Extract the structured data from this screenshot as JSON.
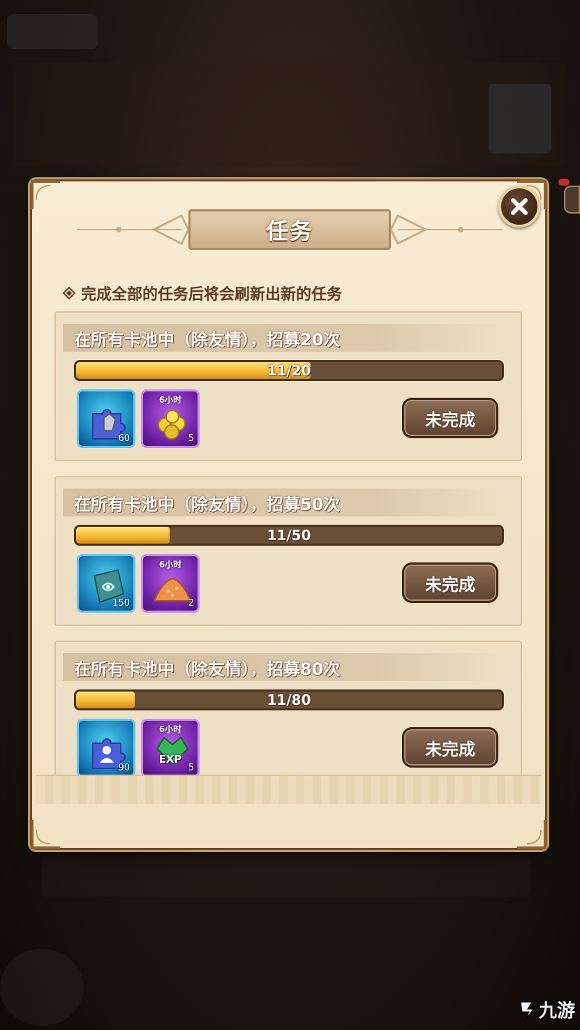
{
  "dialog": {
    "title": "任务"
  },
  "hint": "完成全部的任务后将会刷新出新的任务",
  "tasks": [
    {
      "title": "在所有卡池中（除友情），招募20次",
      "progress_text": "11/20",
      "progress": 0.55,
      "status": "未完成",
      "rewards": [
        {
          "icon": "hero-fragment-icon",
          "qty": "60"
        },
        {
          "icon": "gold-coins-icon",
          "time": "6小时",
          "qty": "5"
        }
      ]
    },
    {
      "title": "在所有卡池中（除友情），招募50次",
      "progress_text": "11/50",
      "progress": 0.22,
      "status": "未完成",
      "rewards": [
        {
          "icon": "rune-stone-icon",
          "qty": "150"
        },
        {
          "icon": "dust-pile-icon",
          "time": "6小时",
          "qty": "2"
        }
      ]
    },
    {
      "title": "在所有卡池中（除友情），招募80次",
      "progress_text": "11/80",
      "progress": 0.1375,
      "status": "未完成",
      "rewards": [
        {
          "icon": "hero-puzzle-icon",
          "qty": "90"
        },
        {
          "icon": "exp-gem-icon",
          "time": "6小时",
          "label": "EXP",
          "qty": "5"
        }
      ]
    }
  ],
  "watermark": "九游",
  "colors": {
    "progress": "#f4b531",
    "panel": "#f1e2c3",
    "button": "#6e503b"
  }
}
